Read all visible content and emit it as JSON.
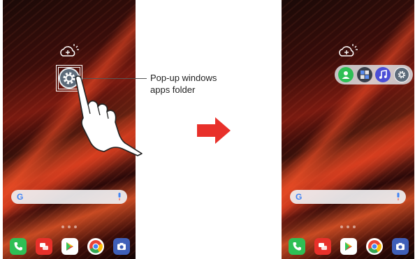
{
  "callout": {
    "line1": "Pop-up windows",
    "line2": "apps folder"
  },
  "left_screen": {
    "weather_icon": "weather-add-icon",
    "folder_icon": "settings-gear-icon",
    "search": {
      "logo": "G",
      "mic_icon": "mic-icon"
    },
    "dock": [
      "phone-icon",
      "messages-icon",
      "play-store-icon",
      "chrome-icon",
      "camera-icon"
    ]
  },
  "right_screen": {
    "weather_icon": "weather-add-icon",
    "folder_apps": [
      "contacts-icon",
      "calculator-icon",
      "music-icon",
      "settings-gear-icon"
    ],
    "search": {
      "logo": "G",
      "mic_icon": "mic-icon"
    },
    "dock": [
      "phone-icon",
      "messages-icon",
      "play-store-icon",
      "chrome-icon",
      "camera-icon"
    ]
  },
  "colors": {
    "arrow": "#e8302a",
    "highlight": "#ffffff",
    "folder_bg": "#dce0e4"
  }
}
